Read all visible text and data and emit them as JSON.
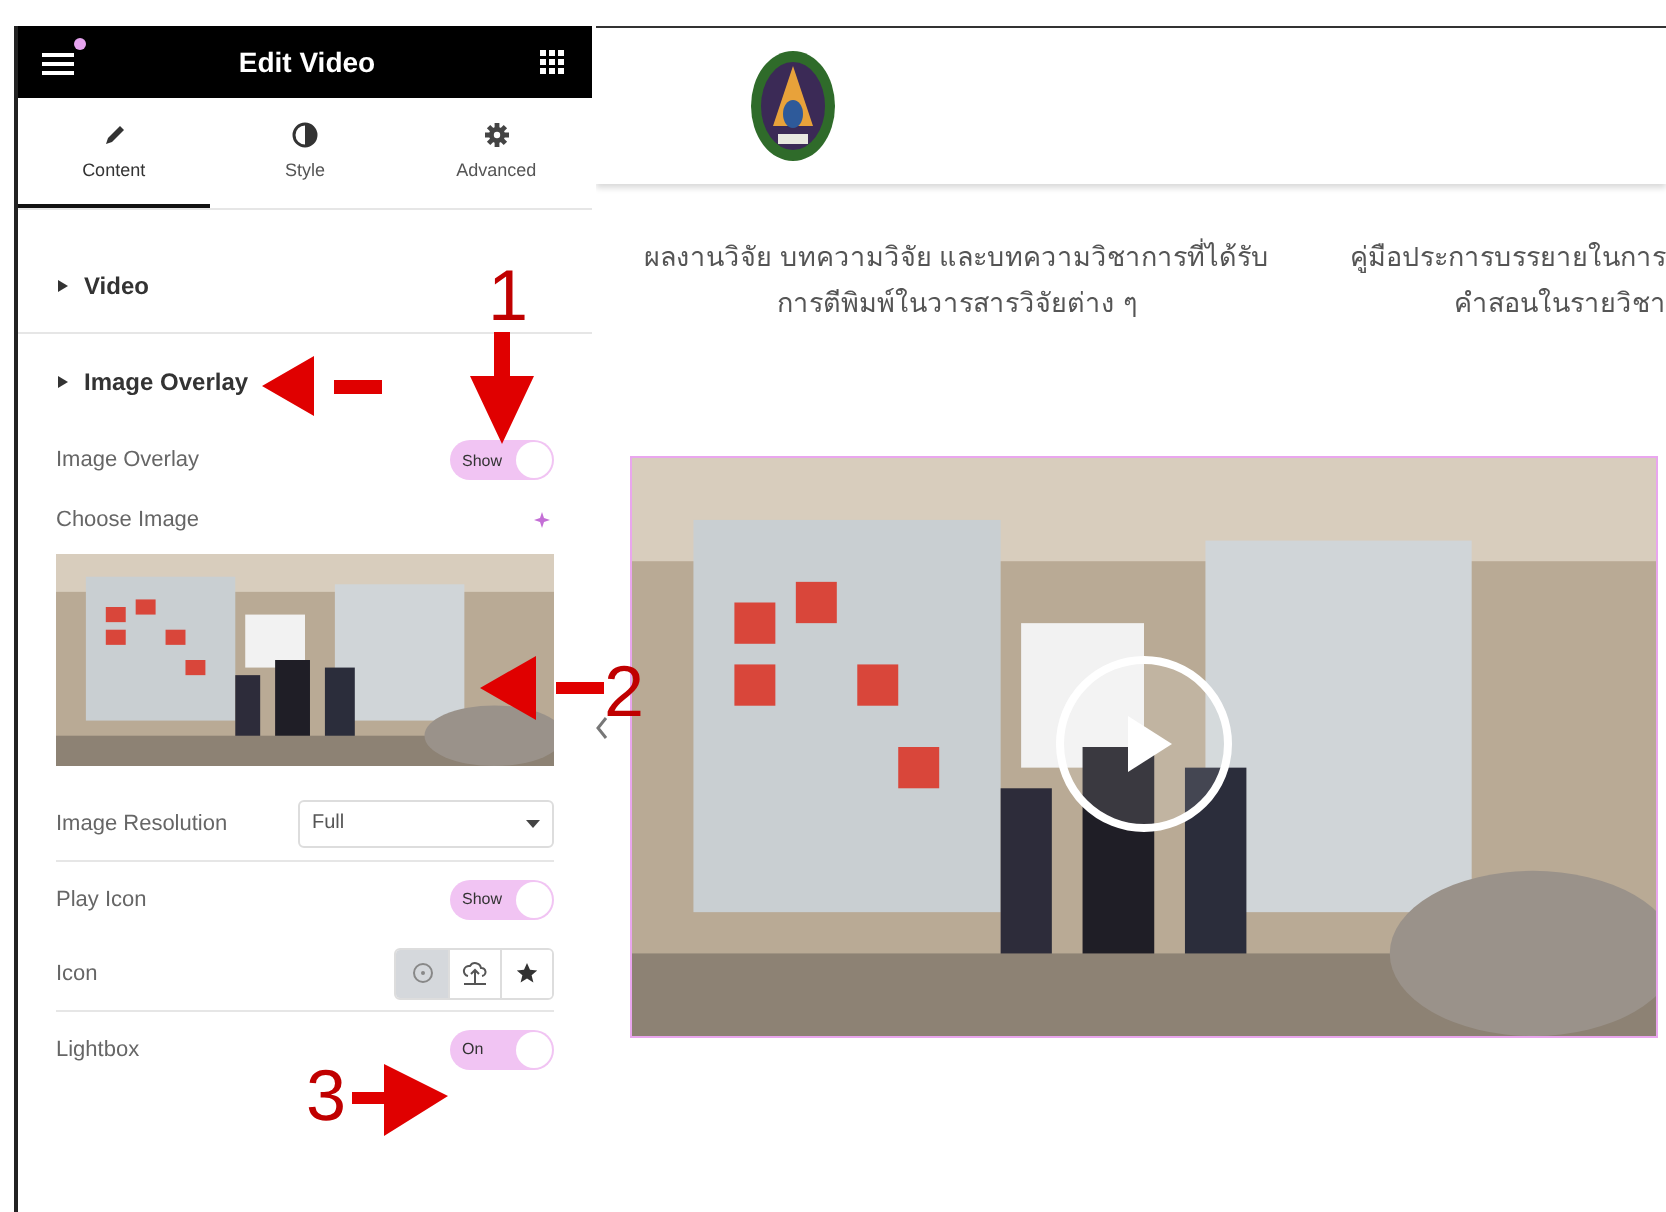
{
  "panel": {
    "title": "Edit Video",
    "notice": true
  },
  "tabs": [
    {
      "label": "Content",
      "kind": "pencil",
      "selected": true
    },
    {
      "label": "Style",
      "kind": "contrast",
      "selected": false
    },
    {
      "label": "Advanced",
      "kind": "gear",
      "selected": false
    }
  ],
  "sections": [
    {
      "title": "Video"
    },
    {
      "title": "Image Overlay"
    }
  ],
  "controls": [
    {
      "kind": "toggle",
      "label": "Image Overlay",
      "value": "Show",
      "on": true
    },
    {
      "kind": "media",
      "label": "Choose Image"
    },
    {
      "kind": "select",
      "label": "Image Resolution",
      "value": "Full"
    },
    {
      "kind": "toggle",
      "label": "Play Icon",
      "value": "Show",
      "on": true
    },
    {
      "kind": "icons",
      "label": "Icon",
      "options": [
        {
          "kind": "circle",
          "selected": true
        },
        {
          "kind": "upload",
          "selected": false
        },
        {
          "kind": "star",
          "selected": false
        }
      ]
    },
    {
      "kind": "toggle",
      "label": "Lightbox",
      "value": "On",
      "on": true
    }
  ],
  "page": {
    "columns": [
      {
        "text": "ผลงานวิจัย บทความวิจัย และบทความวิชาการที่ได้รับ\nการตีพิมพ์ในวารสารวิจัยต่าง ๆ"
      },
      {
        "text": "คู่มือประการบรรยายในการ\nคำสอนในรายวิชา"
      }
    ]
  },
  "annotations": [
    {
      "label": "1"
    },
    {
      "label": "2"
    },
    {
      "label": "3"
    }
  ]
}
